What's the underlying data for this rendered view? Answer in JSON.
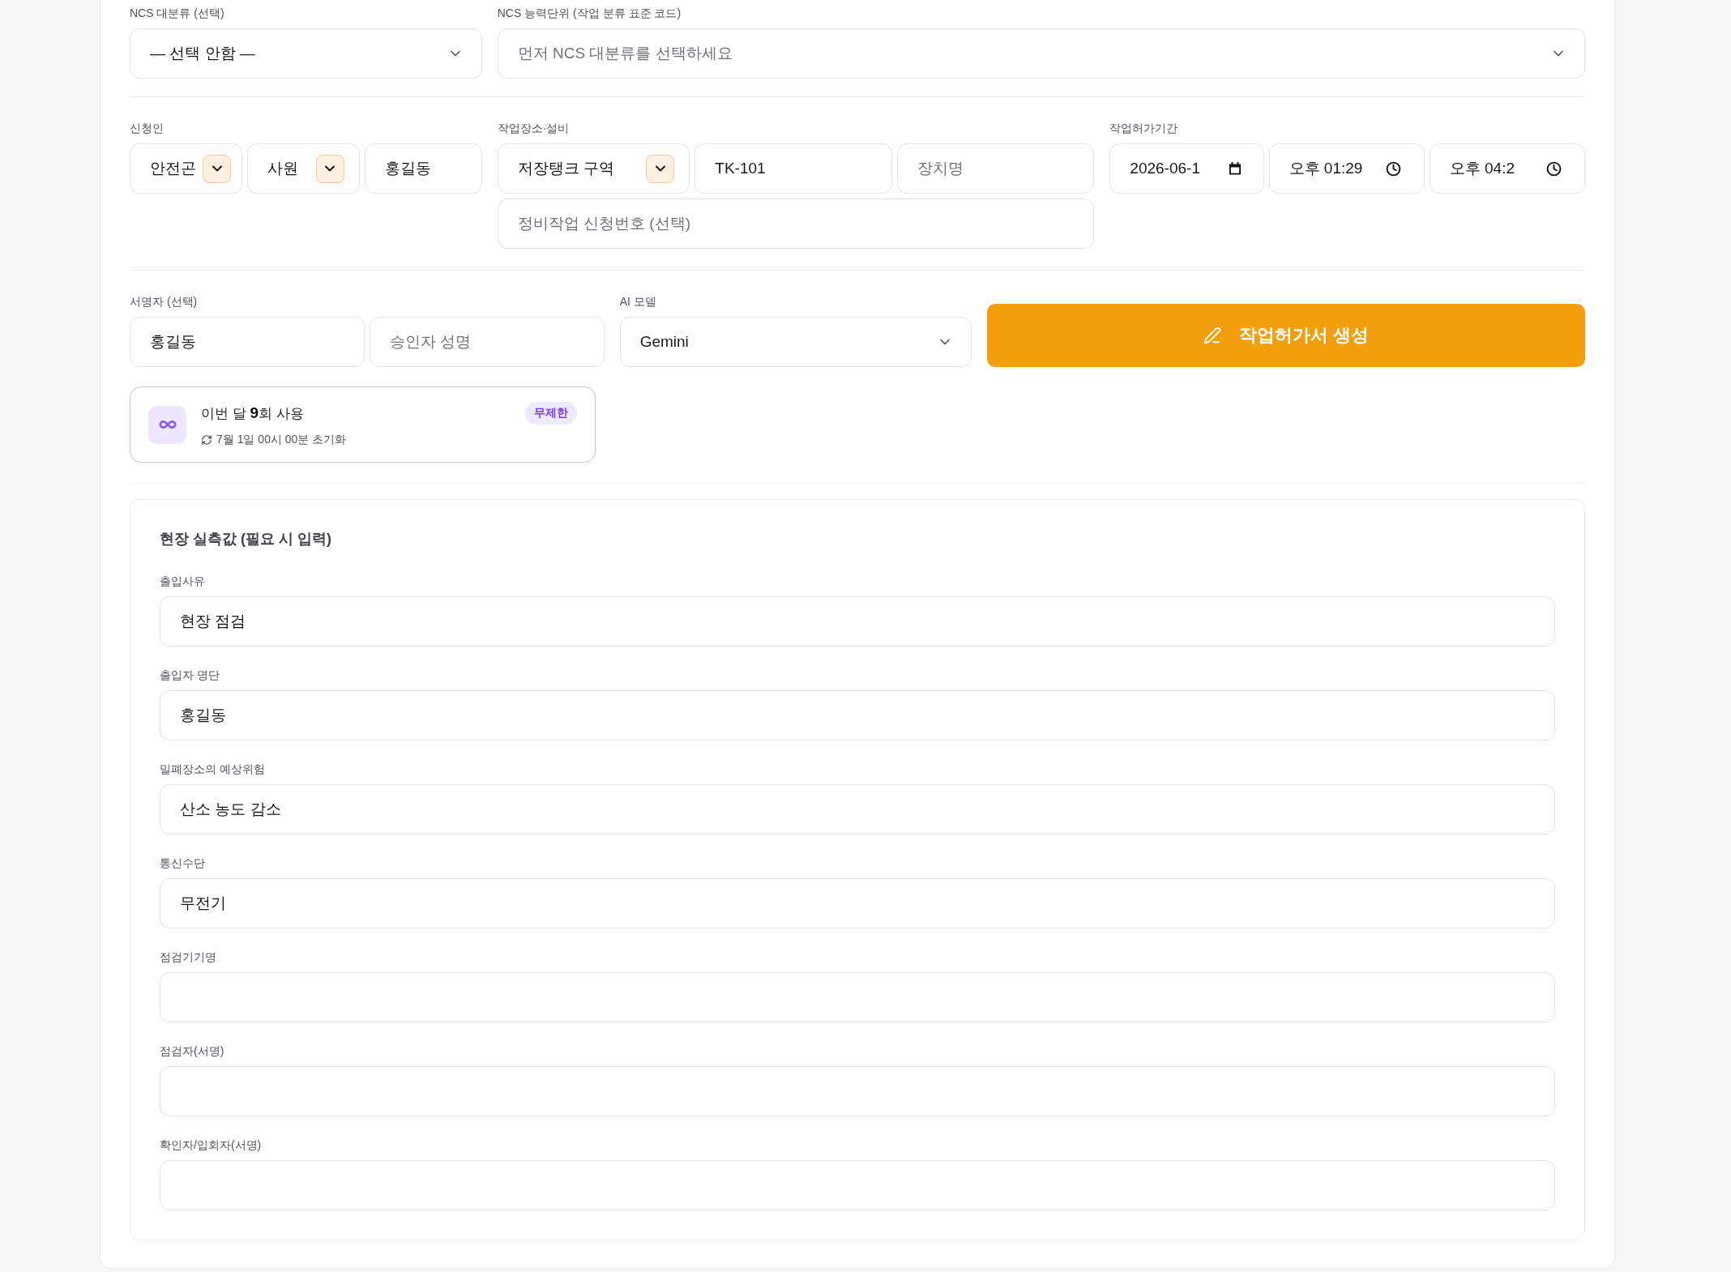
{
  "ncs": [
    {
      "label": "NCS 대분류 (선택)",
      "kind": "dropdown",
      "value": "— 선택 안함 —"
    },
    {
      "label": "NCS 능력단위 (작업 분류 표준 코드)",
      "kind": "dropdown",
      "placeholder": "먼저 NCS 대분류를 선택하세요"
    }
  ],
  "details": [
    {
      "label": "신청인",
      "rows": [
        [
          {
            "kind": "select",
            "value": "안전곤"
          },
          {
            "kind": "select",
            "value": "사원"
          },
          {
            "kind": "text",
            "value": "홍길동"
          }
        ]
      ]
    },
    {
      "label": "작업장소·설비",
      "rows": [
        [
          {
            "kind": "select",
            "value": "저장탱크 구역"
          },
          {
            "kind": "text",
            "value": "TK-101"
          },
          {
            "kind": "text",
            "placeholder": "장치명"
          }
        ],
        [
          {
            "kind": "text",
            "placeholder": "정비작업 신청번호 (선택)"
          }
        ]
      ]
    },
    {
      "label": "작업허가기간",
      "rows": [
        [
          {
            "kind": "date",
            "value": "2026-06-1"
          },
          {
            "kind": "time",
            "value": "오후 01:29"
          },
          {
            "kind": "time",
            "value": "오후 04:2"
          }
        ]
      ]
    }
  ],
  "signer": {
    "label": "서명자 (선택)",
    "fields": [
      {
        "kind": "text",
        "value": "홍길동"
      },
      {
        "kind": "text",
        "placeholder": "승인자 성명"
      }
    ]
  },
  "ai_model": {
    "label": "AI 모델",
    "kind": "dropdown",
    "value": "Gemini"
  },
  "generate_button": {
    "label": "작업허가서 생성"
  },
  "usage": {
    "text": "이번 달 **9**회 사용",
    "reset": "7월 1일 00시 00분 초기화",
    "badge": "무제한"
  },
  "field_values": {
    "title": "현장 실측값 (필요 시 입력)",
    "fields": [
      {
        "label": "출입사유",
        "value": "현장 점검"
      },
      {
        "label": "출입자 명단",
        "value": "홍길동"
      },
      {
        "label": "밀폐장소의 예상위험",
        "value": "산소 농도 감소"
      },
      {
        "label": "통신수단",
        "value": "무전기"
      },
      {
        "label": "점검기기명"
      },
      {
        "label": "점검자(서명)"
      },
      {
        "label": "확인자/입회자(서명)"
      }
    ]
  }
}
